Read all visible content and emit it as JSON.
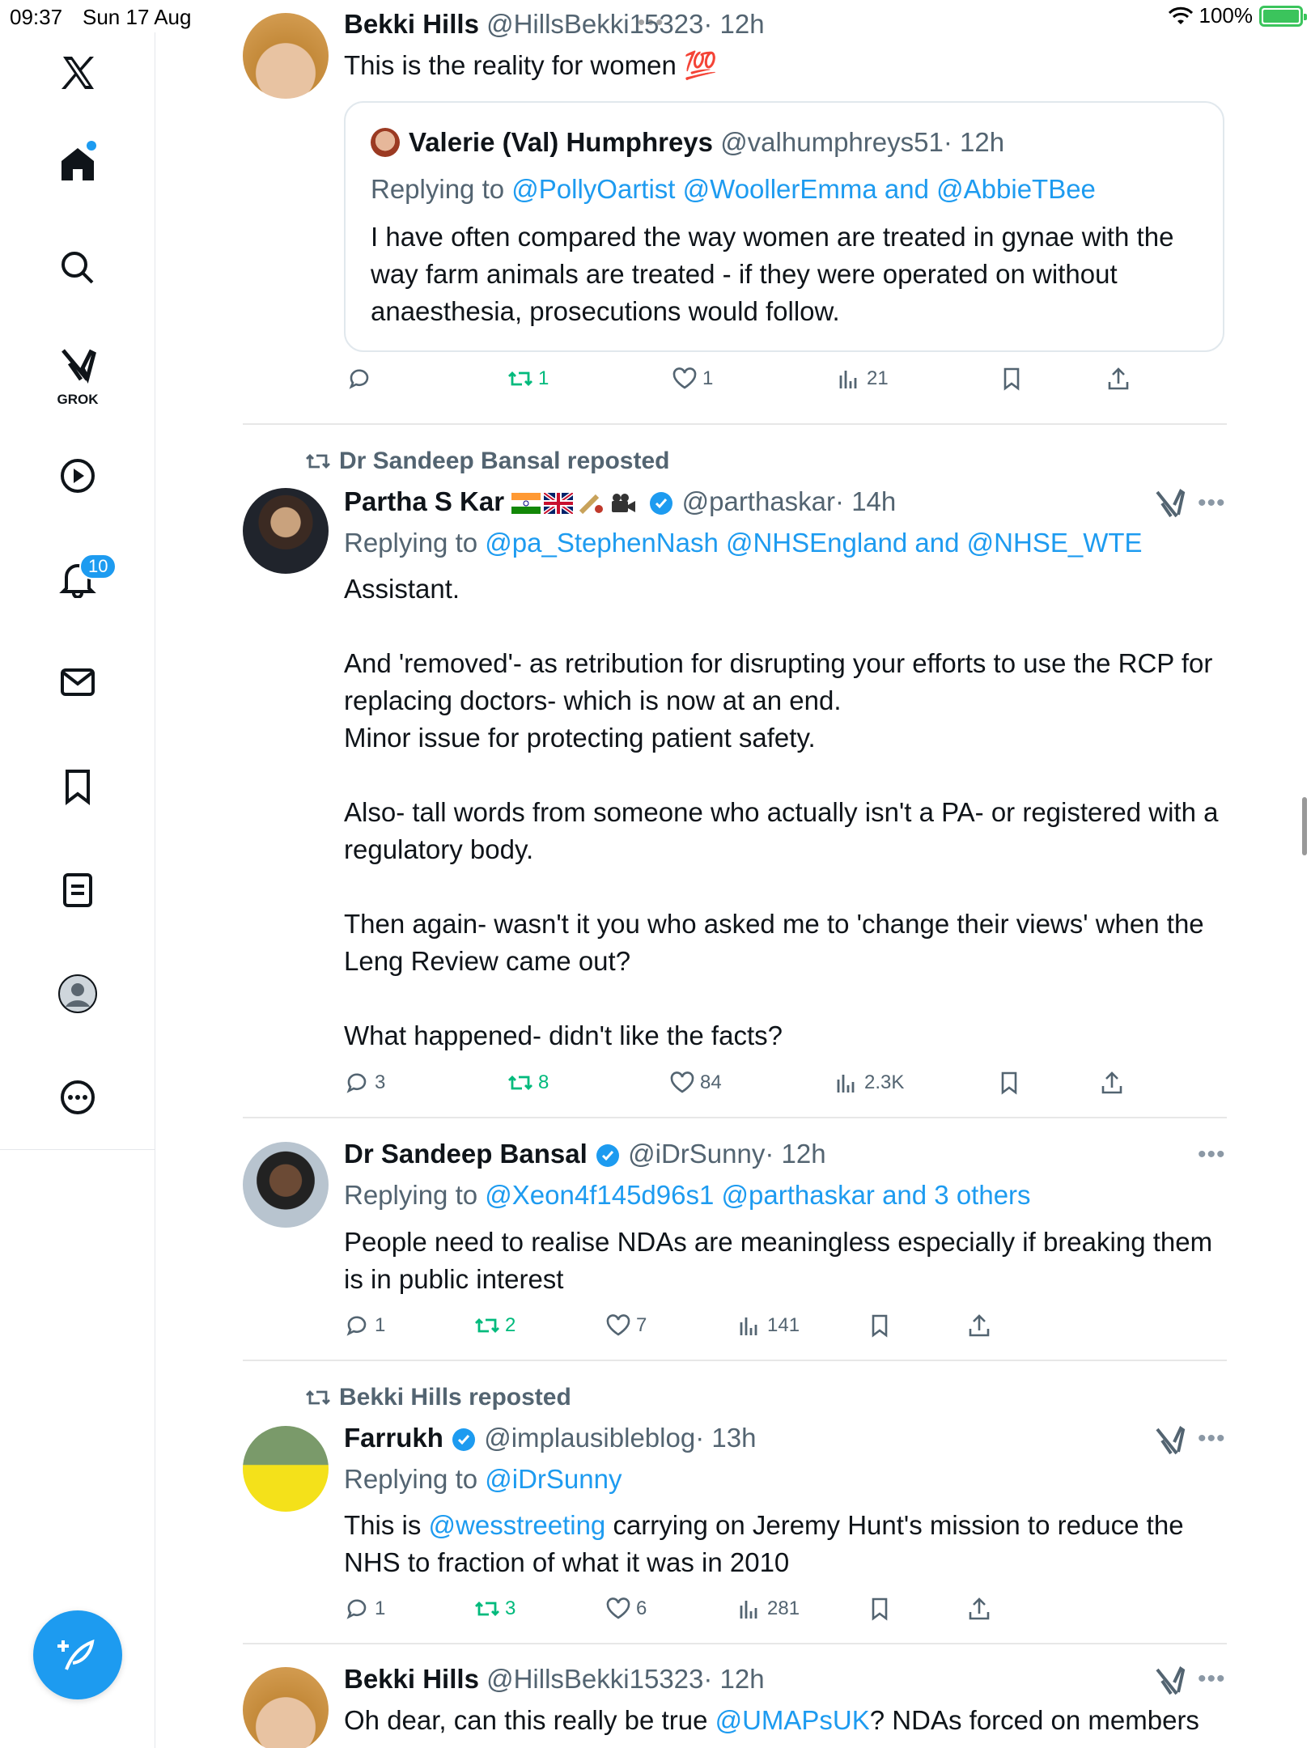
{
  "status_bar": {
    "time": "09:37",
    "date": "Sun 17 Aug",
    "battery": "100%",
    "battery_level": 1.0
  },
  "sidebar": {
    "grok_label": "GROK",
    "notifications_count": "10"
  },
  "tweets": [
    {
      "name": "Bekki Hills",
      "handle": "@HillsBekki15323",
      "time": "· 12h",
      "text": "This is the reality for women 💯",
      "quote": {
        "name": "Valerie (Val) Humphreys",
        "handle": "@valhumphreys51",
        "time": "· 12h",
        "replying_prefix": "Replying to ",
        "replying_to": "@PollyOartist @WoollerEmma and @AbbieTBee",
        "text": "I have often compared the way women are treated in gynae with the way farm animals are treated - if they were operated on without anaesthesia, prosecutions would follow."
      },
      "replies": "",
      "retweets": "1",
      "likes": "1",
      "views": "21"
    },
    {
      "repost_label": "Dr Sandeep Bansal reposted",
      "name": "Partha S Kar",
      "handle": "@parthaskar",
      "time": "· 14h",
      "replying_prefix": "Replying to ",
      "replying_to": "@pa_StephenNash @NHSEngland and @NHSE_WTE",
      "paragraphs": [
        "Assistant.",
        "And 'removed'- as retribution for disrupting your efforts to use the RCP for replacing doctors- which is now at an end.\nMinor issue for protecting patient safety.",
        "Also- tall words from someone who actually isn't a PA- or registered with a regulatory body.",
        "Then again- wasn't it you who asked me to 'change their views' when the Leng Review came out?",
        "What happened- didn't like the facts?"
      ],
      "replies": "3",
      "retweets": "8",
      "likes": "84",
      "views": "2.3K"
    },
    {
      "name": "Dr Sandeep Bansal",
      "handle": "@iDrSunny",
      "time": "· 12h",
      "replying_prefix": "Replying to ",
      "replying_to": "@Xeon4f145d96s1 @parthaskar and 3 others",
      "text": "People need to realise NDAs are meaningless especially if breaking them is in public interest",
      "replies": "1",
      "retweets": "2",
      "likes": "7",
      "views": "141"
    },
    {
      "repost_label": "Bekki Hills reposted",
      "name": "Farrukh",
      "handle": "@implausibleblog",
      "time": "· 13h",
      "replying_prefix": "Replying to ",
      "replying_to": "@iDrSunny",
      "text_mention": "@wesstreeting",
      "text_prefix": "This is ",
      "text_rest": " carrying on Jeremy Hunt's mission to reduce the NHS to fraction of what it was in 2010",
      "replies": "1",
      "retweets": "3",
      "likes": "6",
      "views": "281"
    },
    {
      "name": "Bekki Hills",
      "handle": "@HillsBekki15323",
      "time": "· 12h",
      "text_prefix": "Oh dear, can this really be true ",
      "text_mention": "@UMAPsUK",
      "text_rest": "? NDAs forced on members"
    }
  ]
}
